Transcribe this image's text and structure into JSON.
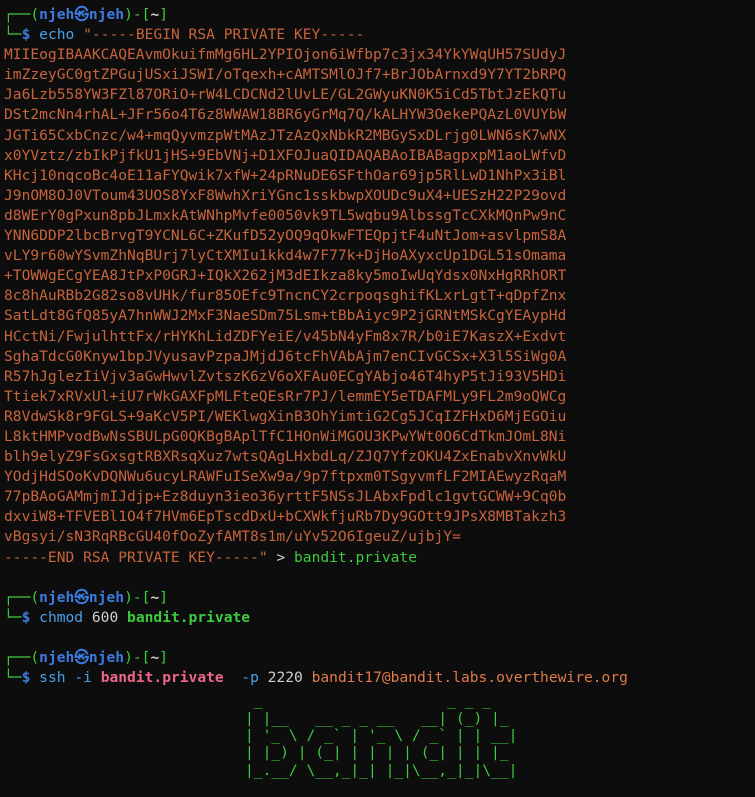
{
  "prompt": {
    "user": "njeh",
    "host": "njeh",
    "cwd": "~"
  },
  "commands": {
    "echo": {
      "verb": "echo",
      "quote_open": "\"",
      "begin": "-----BEGIN RSA PRIVATE KEY-----",
      "end": "-----END RSA PRIVATE KEY-----",
      "quote_close": "\"",
      "redirect": ">",
      "target": "bandit.private"
    },
    "chmod": {
      "verb": "chmod",
      "mode": "600",
      "target": "bandit.private"
    },
    "ssh": {
      "verb": "ssh",
      "flag_i": "-i",
      "keyfile": "bandit.private",
      "flag_p": "-p",
      "port": "2220",
      "dest": "bandit17@bandit.labs.overthewire.org"
    }
  },
  "key_lines": [
    "MIIEogIBAAKCAQEAvmOkuifmMg6HL2YPIOjon6iWfbp7c3jx34YkYWqUH57SUdyJ",
    "imZzeyGC0gtZPGujUSxiJSWI/oTqexh+cAMTSMlOJf7+BrJObArnxd9Y7YT2bRPQ",
    "Ja6Lzb558YW3FZl87ORiO+rW4LCDCNd2lUvLE/GL2GWyuKN0K5iCd5TbtJzEkQTu",
    "DSt2mcNn4rhAL+JFr56o4T6z8WWAW18BR6yGrMq7Q/kALHYW3OekePQAzL0VUYbW",
    "JGTi65CxbCnzc/w4+mqQyvmzpWtMAzJTzAzQxNbkR2MBGySxDLrjg0LWN6sK7wNX",
    "x0YVztz/zbIkPjfkU1jHS+9EbVNj+D1XFOJuaQIDAQABAoIBABagpxpM1aoLWfvD",
    "KHcj10nqcoBc4oE11aFYQwik7xfW+24pRNuDE6SFthOar69jp5RlLwD1NhPx3iBl",
    "J9nOM8OJ0VToum43UOS8YxF8WwhXriYGnc1sskbwpXOUDc9uX4+UESzH22P29ovd",
    "d8WErY0gPxun8pbJLmxkAtWNhpMvfe0050vk9TL5wqbu9AlbssgTcCXkMQnPw9nC",
    "YNN6DDP2lbcBrvgT9YCNL6C+ZKufD52yOQ9qOkwFTEQpjtF4uNtJom+asvlpmS8A",
    "vLY9r60wYSvmZhNqBUrj7lyCtXMIu1kkd4w7F77k+DjHoAXyxcUp1DGL51sOmama",
    "+TOWWgECgYEA8JtPxP0GRJ+IQkX262jM3dEIkza8ky5moIwUqYdsx0NxHgRRhORT",
    "8c8hAuRBb2G82so8vUHk/fur85OEfc9TncnCY2crpoqsghifKLxrLgtT+qDpfZnx",
    "SatLdt8GfQ85yA7hnWWJ2MxF3NaeSDm75Lsm+tBbAiyc9P2jGRNtMSkCgYEAypHd",
    "HCctNi/FwjulhttFx/rHYKhLidZDFYeiE/v45bN4yFm8x7R/b0iE7KaszX+Exdvt",
    "SghaTdcG0Knyw1bpJVyusavPzpaJMjdJ6tcFhVAbAjm7enCIvGCSx+X3l5SiWg0A",
    "R57hJglezIiVjv3aGwHwvlZvtszK6zV6oXFAu0ECgYAbjo46T4hyP5tJi93V5HDi",
    "Ttiek7xRVxUl+iU7rWkGAXFpMLFteQEsRr7PJ/lemmEY5eTDAFMLy9FL2m9oQWCg",
    "R8VdwSk8r9FGLS+9aKcV5PI/WEKlwgXinB3OhYimtiG2Cg5JCqIZFHxD6MjEGOiu",
    "L8ktHMPvodBwNsSBULpG0QKBgBAplTfC1HOnWiMGOU3KPwYWt0O6CdTkmJOmL8Ni",
    "blh9elyZ9FsGxsgtRBXRsqXuz7wtsQAgLHxbdLq/ZJQ7YfzOKU4ZxEnabvXnvWkU",
    "YOdjHdSOoKvDQNWu6ucyLRAWFuISeXw9a/9p7ftpxm0TSgyvmfLF2MIAEwyzRqaM",
    "77pBAoGAMmjmIJdjp+Ez8duyn3ieo36yrttF5NSsJLAbxFpdlc1gvtGCWW+9Cq0b",
    "dxviW8+TFVEBl1O4f7HVm6EpTscdDxU+bCXWkfjuRb7Dy9GOtt9JPsX8MBTakzh3",
    "vBgsyi/sN3RqRBcGU40fOoZyfAMT8s1m/uYv52O6IgeuZ/ujbjY="
  ],
  "banner": [
    " _                     _ _ _   ",
    "| |__   __ _ _ __   __| (_) |_ ",
    "| '_ \\ / _` | '_ \\ / _` | | __|",
    "| |_) | (_| | | | | (_| | | |_ ",
    "|_.__/ \\__,_|_| |_|\\__,_|_|\\__|"
  ]
}
